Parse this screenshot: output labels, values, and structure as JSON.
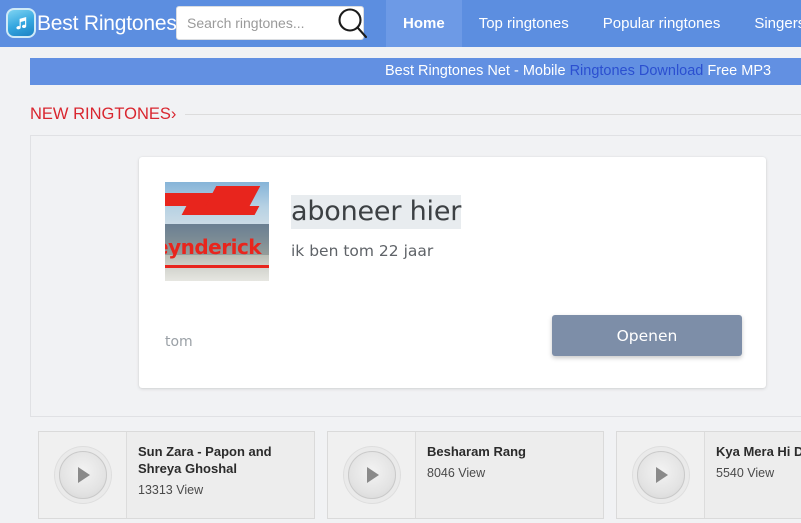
{
  "header": {
    "brand_name": "Best Ringtones",
    "logo_icon": "music-note-icon",
    "search": {
      "placeholder": "Search ringtones...",
      "value": "",
      "icon": "search-icon"
    },
    "nav": [
      {
        "label": "Home",
        "active": true
      },
      {
        "label": "Top ringtones",
        "active": false
      },
      {
        "label": "Popular ringtones",
        "active": false
      },
      {
        "label": "Singers",
        "active": false
      }
    ],
    "background_color": "#5c8ee0",
    "active_tab_color": "#6d9ae6"
  },
  "titlebar": {
    "part1": "Best Ringtones Net - Mobile ",
    "highlight": "Ringtones Download",
    "part2": " Free MP3",
    "background_color": "#6290e2",
    "highlight_color": "#2b4fd0"
  },
  "section": {
    "title": "NEW RINGTONES›",
    "title_color": "#d9262f"
  },
  "dialog": {
    "thumbnail": {
      "name": "channel-thumbnail",
      "wordmark": "eynderick"
    },
    "title": "aboneer hier",
    "subtitle": "ik ben tom 22 jaar",
    "owner": "tom",
    "open_button": "Openen",
    "button_color": "#7d8ea8"
  },
  "ringtones": [
    {
      "title": "Sun Zara - Papon and Shreya Ghoshal",
      "views": "13313 View",
      "play_icon": "play-icon"
    },
    {
      "title": "Besharam Rang",
      "views": "8046 View",
      "play_icon": "play-icon"
    },
    {
      "title": "Kya Mera Hi Dil Bhatt",
      "views": "5540 View",
      "play_icon": "play-icon"
    }
  ]
}
